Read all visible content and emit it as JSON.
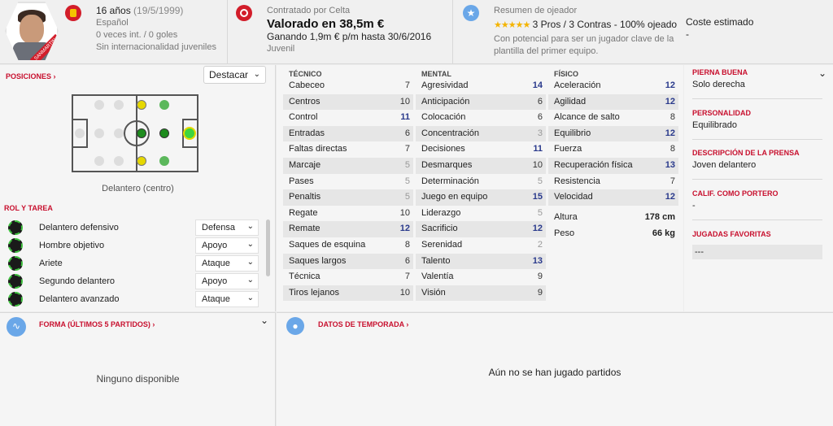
{
  "header": {
    "avatar_name": "SANMARTIN",
    "age": "16 años",
    "dob": "(19/5/1999)",
    "nationality": "Español",
    "caps": "0 veces int. / 0 goles",
    "youth": "Sin internacionalidad juveniles",
    "contract_title": "Contratado por Celta",
    "value": "Valorado en 38,5m €",
    "wage": "Ganando 1,9m € p/m hasta 30/6/2016",
    "squad": "Juvenil",
    "scout_title": "Resumen de ojeador",
    "scout_stars": "★★★★★",
    "scout_summary": "3 Pros / 3 Contras - 100% ojeado",
    "scout_note": "Con potencial para ser un jugador clave de la plantilla del primer equipo.",
    "cost_title": "Coste estimado",
    "cost_value": "-"
  },
  "positions": {
    "title": "POSICIONES ›",
    "select": "Destacar",
    "position_label": "Delantero (centro)"
  },
  "roles": {
    "title": "ROL Y TAREA",
    "items": [
      {
        "name": "Delantero defensivo",
        "duty": "Defensa"
      },
      {
        "name": "Hombre objetivo",
        "duty": "Apoyo"
      },
      {
        "name": "Ariete",
        "duty": "Ataque"
      },
      {
        "name": "Segundo delantero",
        "duty": "Apoyo"
      },
      {
        "name": "Delantero avanzado",
        "duty": "Ataque"
      }
    ]
  },
  "attributes": {
    "tecnico": {
      "title": "TÉCNICO",
      "rows": [
        {
          "n": "Cabeceo",
          "v": "7"
        },
        {
          "n": "Centros",
          "v": "10"
        },
        {
          "n": "Control",
          "v": "11"
        },
        {
          "n": "Entradas",
          "v": "6"
        },
        {
          "n": "Faltas directas",
          "v": "7"
        },
        {
          "n": "Marcaje",
          "v": "5"
        },
        {
          "n": "Pases",
          "v": "5"
        },
        {
          "n": "Penaltis",
          "v": "5"
        },
        {
          "n": "Regate",
          "v": "10"
        },
        {
          "n": "Remate",
          "v": "12"
        },
        {
          "n": "Saques de esquina",
          "v": "8"
        },
        {
          "n": "Saques largos",
          "v": "6"
        },
        {
          "n": "Técnica",
          "v": "7"
        },
        {
          "n": "Tiros lejanos",
          "v": "10"
        }
      ]
    },
    "mental": {
      "title": "MENTAL",
      "rows": [
        {
          "n": "Agresividad",
          "v": "14"
        },
        {
          "n": "Anticipación",
          "v": "6"
        },
        {
          "n": "Colocación",
          "v": "6"
        },
        {
          "n": "Concentración",
          "v": "3"
        },
        {
          "n": "Decisiones",
          "v": "11"
        },
        {
          "n": "Desmarques",
          "v": "10"
        },
        {
          "n": "Determinación",
          "v": "5"
        },
        {
          "n": "Juego en equipo",
          "v": "15"
        },
        {
          "n": "Liderazgo",
          "v": "5"
        },
        {
          "n": "Sacrificio",
          "v": "12"
        },
        {
          "n": "Serenidad",
          "v": "2"
        },
        {
          "n": "Talento",
          "v": "13"
        },
        {
          "n": "Valentía",
          "v": "9"
        },
        {
          "n": "Visión",
          "v": "9"
        }
      ]
    },
    "fisico": {
      "title": "FÍSICO",
      "rows": [
        {
          "n": "Aceleración",
          "v": "12"
        },
        {
          "n": "Agilidad",
          "v": "12"
        },
        {
          "n": "Alcance de salto",
          "v": "8"
        },
        {
          "n": "Equilibrio",
          "v": "12"
        },
        {
          "n": "Fuerza",
          "v": "8"
        },
        {
          "n": "Recuperación física",
          "v": "13"
        },
        {
          "n": "Resistencia",
          "v": "7"
        },
        {
          "n": "Velocidad",
          "v": "12"
        }
      ]
    },
    "height_label": "Altura",
    "height": "178 cm",
    "weight_label": "Peso",
    "weight": "66 kg"
  },
  "info": {
    "foot_label": "PIERNA BUENA",
    "foot": "Solo derecha",
    "personality_label": "PERSONALIDAD",
    "personality": "Equilibrado",
    "press_label": "DESCRIPCIÓN DE LA PRENSA",
    "press": "Joven delantero",
    "gk_label": "CALIF. COMO PORTERO",
    "gk": "-",
    "moves_label": "JUGADAS FAVORITAS",
    "moves": "---"
  },
  "form": {
    "title": "FORMA (ÚLTIMOS 5 PARTIDOS) ›",
    "empty": "Ninguno disponible"
  },
  "season": {
    "title": "DATOS DE TEMPORADA ›",
    "empty": "Aún no se han jugado partidos"
  }
}
